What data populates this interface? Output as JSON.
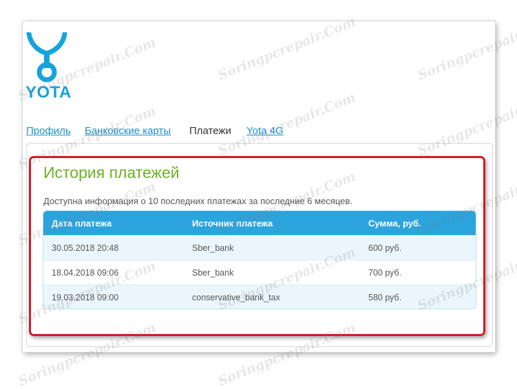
{
  "logo": {
    "text": "YOTA",
    "color": "#17a3dc"
  },
  "tabs": [
    {
      "label": "Профиль",
      "active": false
    },
    {
      "label": "Банковские карты",
      "active": false
    },
    {
      "label": "Платежи",
      "active": true
    },
    {
      "label": "Yota 4G",
      "active": false
    }
  ],
  "section": {
    "title": "История платежей",
    "description": "Доступна информация о 10 последних платежах за последние 6 месяцев."
  },
  "table": {
    "headers": [
      "Дата платежа",
      "Источник платежа",
      "Сумма, руб."
    ],
    "rows": [
      [
        "30.05.2018 20:48",
        "Sber_bank",
        "600 руб."
      ],
      [
        "18.04.2018 09:06",
        "Sber_bank",
        "700 руб."
      ],
      [
        "19.03.2018 09:00",
        "conservative_bank_tax",
        "580 руб."
      ]
    ]
  },
  "watermark": "Soringpcrepair.Com",
  "colors": {
    "accent": "#2ba4de",
    "title": "#6bb226",
    "highlight": "#d71920",
    "link": "#1d8fca"
  }
}
